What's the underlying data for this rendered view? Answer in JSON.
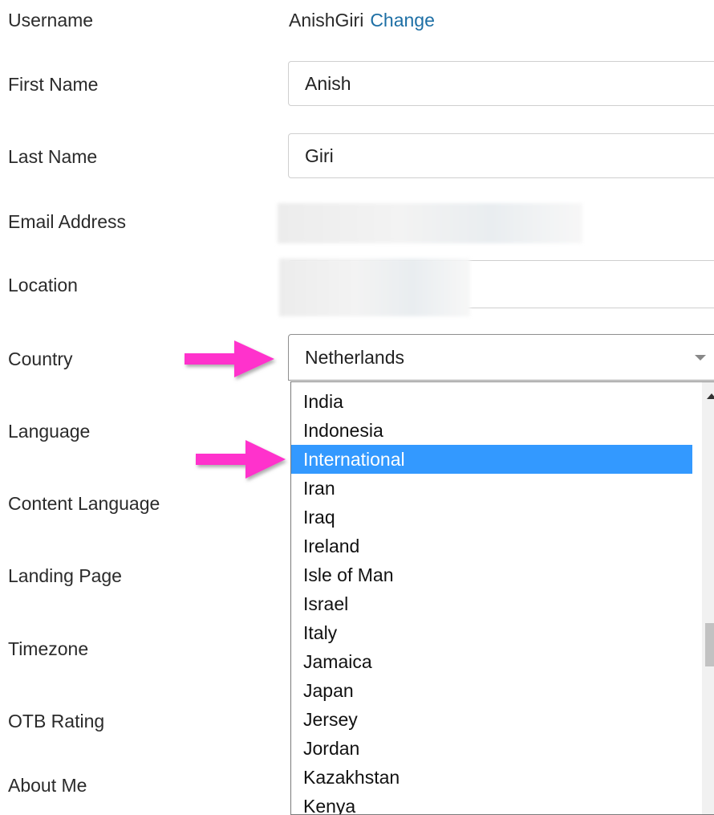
{
  "form": {
    "username": {
      "label": "Username",
      "value": "AnishGiri",
      "link": "Change"
    },
    "first_name": {
      "label": "First Name",
      "value": "Anish"
    },
    "last_name": {
      "label": "Last Name",
      "value": "Giri"
    },
    "email": {
      "label": "Email Address"
    },
    "location": {
      "label": "Location"
    },
    "country": {
      "label": "Country",
      "value": "Netherlands"
    },
    "language": {
      "label": "Language"
    },
    "content_language": {
      "label": "Content Language"
    },
    "landing_page": {
      "label": "Landing Page"
    },
    "timezone": {
      "label": "Timezone"
    },
    "otb_rating": {
      "label": "OTB Rating"
    },
    "about_me": {
      "label": "About Me"
    }
  },
  "dropdown": {
    "options": [
      "India",
      "Indonesia",
      "International",
      "Iran",
      "Iraq",
      "Ireland",
      "Isle of Man",
      "Israel",
      "Italy",
      "Jamaica",
      "Japan",
      "Jersey",
      "Jordan",
      "Kazakhstan",
      "Kenya"
    ],
    "highlighted": "International"
  },
  "colors": {
    "link": "#1d6fa5",
    "highlight": "#3399ff",
    "annotation_arrow": "#ff33cc"
  }
}
